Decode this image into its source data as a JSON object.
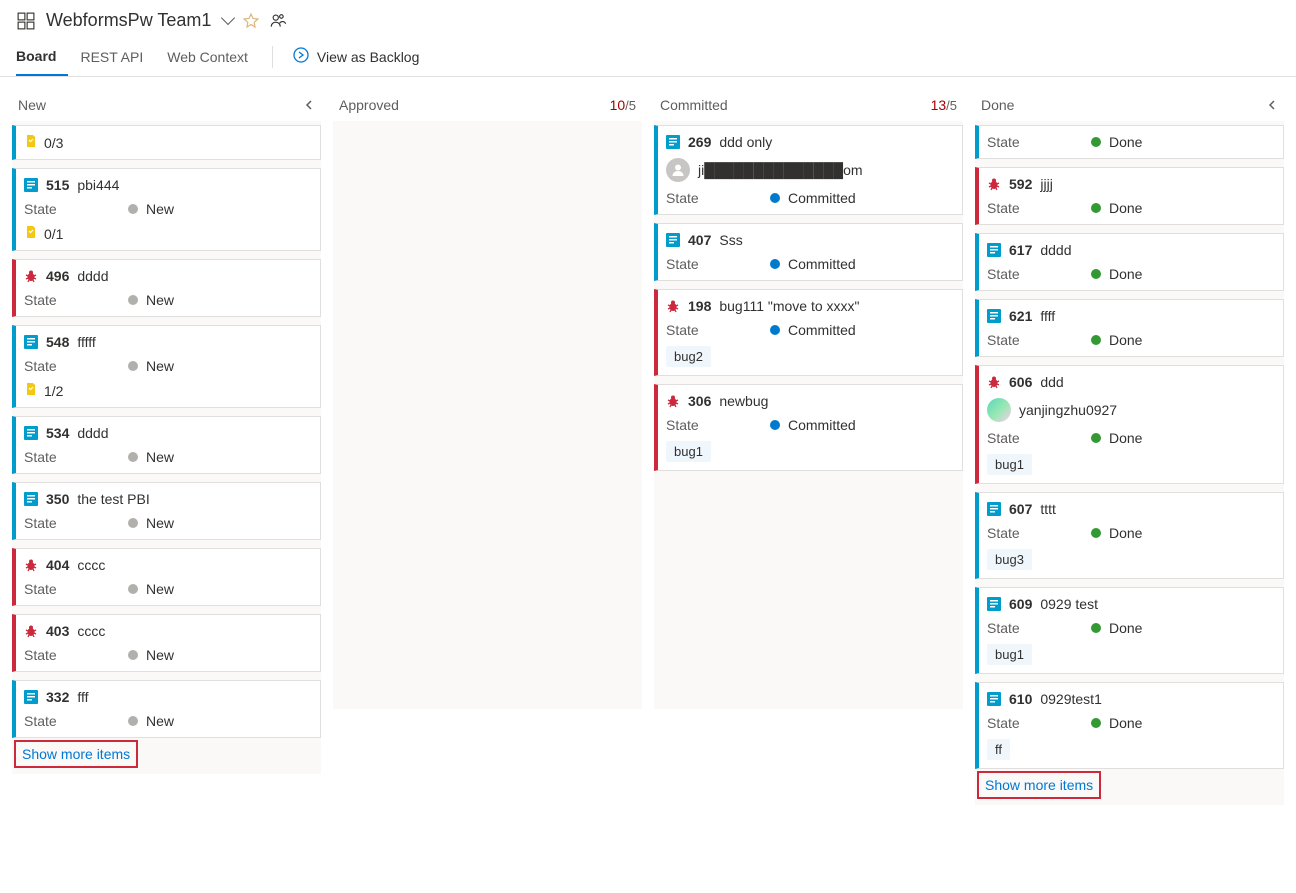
{
  "header": {
    "team_name": "WebformsPw Team1"
  },
  "tabs": {
    "board": "Board",
    "rest_api": "REST API",
    "web_context": "Web Context",
    "view_backlog": "View as Backlog"
  },
  "columns": {
    "new": {
      "title": "New",
      "show_more": "Show more items",
      "cards": [
        {
          "type": "pbi",
          "tasks": "0/3"
        },
        {
          "type": "pbi",
          "id": "515",
          "title": "pbi444",
          "state_label": "State",
          "state": "New",
          "tasks": "0/1"
        },
        {
          "type": "bug",
          "id": "496",
          "title": "dddd",
          "state_label": "State",
          "state": "New"
        },
        {
          "type": "pbi",
          "id": "548",
          "title": "fffff",
          "state_label": "State",
          "state": "New",
          "tasks": "1/2"
        },
        {
          "type": "pbi",
          "id": "534",
          "title": "dddd",
          "state_label": "State",
          "state": "New"
        },
        {
          "type": "pbi",
          "id": "350",
          "title": "the test PBI",
          "state_label": "State",
          "state": "New"
        },
        {
          "type": "bug",
          "id": "404",
          "title": "cccc",
          "state_label": "State",
          "state": "New"
        },
        {
          "type": "bug",
          "id": "403",
          "title": "cccc",
          "state_label": "State",
          "state": "New"
        },
        {
          "type": "pbi",
          "id": "332",
          "title": "fff",
          "state_label": "State",
          "state": "New"
        }
      ]
    },
    "approved": {
      "title": "Approved",
      "wip_count": "10",
      "wip_limit": "/5",
      "cards": []
    },
    "committed": {
      "title": "Committed",
      "wip_count": "13",
      "wip_limit": "/5",
      "cards": [
        {
          "type": "pbi",
          "id": "269",
          "title": "ddd only",
          "assignee": "ji██████████████om",
          "state_label": "State",
          "state": "Committed"
        },
        {
          "type": "pbi",
          "id": "407",
          "title": "Sss",
          "state_label": "State",
          "state": "Committed"
        },
        {
          "type": "bug",
          "id": "198",
          "title": "bug111 \"move to xxxx\"",
          "state_label": "State",
          "state": "Committed",
          "tags": [
            "bug2"
          ]
        },
        {
          "type": "bug",
          "id": "306",
          "title": "newbug",
          "state_label": "State",
          "state": "Committed",
          "tags": [
            "bug1"
          ]
        }
      ]
    },
    "done": {
      "title": "Done",
      "show_more": "Show more items",
      "cards": [
        {
          "type": "pbi",
          "state_label": "State",
          "state": "Done"
        },
        {
          "type": "bug",
          "id": "592",
          "title": "jjjj",
          "state_label": "State",
          "state": "Done"
        },
        {
          "type": "pbi",
          "id": "617",
          "title": "dddd",
          "state_label": "State",
          "state": "Done"
        },
        {
          "type": "pbi",
          "id": "621",
          "title": "ffff",
          "state_label": "State",
          "state": "Done"
        },
        {
          "type": "bug",
          "id": "606",
          "title": "ddd",
          "assignee": "yanjingzhu0927",
          "avatar": "gradient",
          "state_label": "State",
          "state": "Done",
          "tags": [
            "bug1"
          ]
        },
        {
          "type": "pbi",
          "id": "607",
          "title": "tttt",
          "state_label": "State",
          "state": "Done",
          "tags": [
            "bug3"
          ]
        },
        {
          "type": "pbi",
          "id": "609",
          "title": "0929 test",
          "state_label": "State",
          "state": "Done",
          "tags": [
            "bug1"
          ]
        },
        {
          "type": "pbi",
          "id": "610",
          "title": "0929test1",
          "state_label": "State",
          "state": "Done",
          "tags": [
            "ff"
          ]
        }
      ]
    }
  }
}
